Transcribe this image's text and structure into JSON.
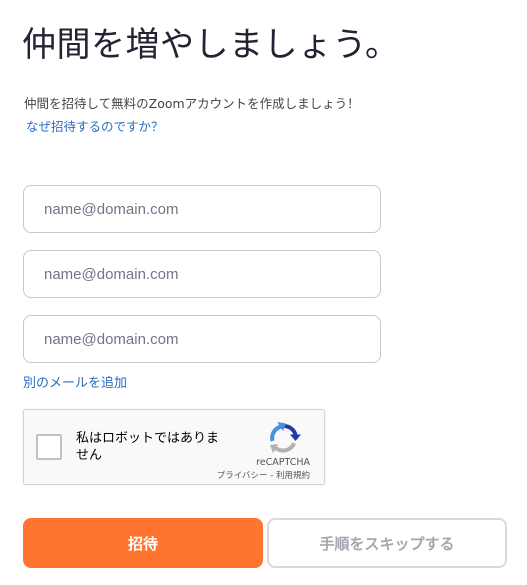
{
  "header": {
    "title": "仲間を増やしましょう。",
    "subtitle": "仲間を招待して無料のZoomアカウントを作成しましょう！",
    "why_link": "なぜ招待するのですか？"
  },
  "form": {
    "email_placeholder": "name@domain.com",
    "emails": [
      {
        "value": "",
        "placeholder": "name@domain.com"
      },
      {
        "value": "",
        "placeholder": "name@domain.com"
      },
      {
        "value": "",
        "placeholder": "name@domain.com"
      }
    ],
    "add_email_link": "別のメールを追加"
  },
  "captcha": {
    "label": "私はロボットではありません",
    "brand": "reCAPTCHA",
    "terms": "プライバシー - 利用規約",
    "checked": false,
    "logo_icon": "recaptcha-logo-icon"
  },
  "actions": {
    "invite_label": "招待",
    "skip_label": "手順をスキップする"
  },
  "colors": {
    "primary": "#ff742e",
    "link": "#2b6cc4",
    "text": "#232333",
    "border": "#c8c8cc",
    "skip_text": "#a6a6b0"
  }
}
